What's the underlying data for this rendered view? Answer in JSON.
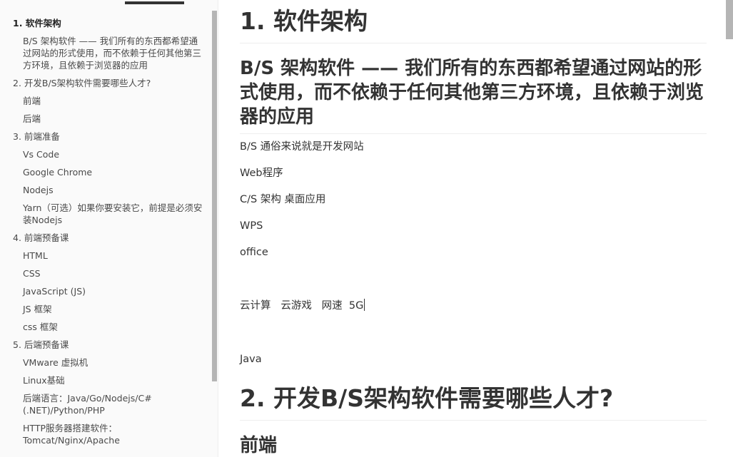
{
  "sidebar": {
    "outline": [
      {
        "level": 1,
        "label": "1. 软件架构",
        "active": true
      },
      {
        "level": 2,
        "label": "B/S 架构软件 —— 我们所有的东西都希望通过网站的形式使用，而不依赖于任何其他第三方环境，且依赖于浏览器的应用"
      },
      {
        "level": 1,
        "label": "2. 开发B/S架构软件需要哪些人才?"
      },
      {
        "level": 2,
        "label": "前端"
      },
      {
        "level": 2,
        "label": "后端"
      },
      {
        "level": 1,
        "label": "3. 前端准备"
      },
      {
        "level": 2,
        "label": "Vs Code"
      },
      {
        "level": 2,
        "label": "Google Chrome"
      },
      {
        "level": 2,
        "label": "Nodejs"
      },
      {
        "level": 2,
        "label": "Yarn（可选）如果你要安装它，前提是必须安装Nodejs"
      },
      {
        "level": 1,
        "label": "4. 前端预备课"
      },
      {
        "level": 2,
        "label": "HTML"
      },
      {
        "level": 2,
        "label": "CSS"
      },
      {
        "level": 2,
        "label": "JavaScript (JS)"
      },
      {
        "level": 2,
        "label": "JS 框架"
      },
      {
        "level": 2,
        "label": "css 框架"
      },
      {
        "level": 1,
        "label": "5. 后端预备课"
      },
      {
        "level": 2,
        "label": "VMware 虚拟机"
      },
      {
        "level": 2,
        "label": "Linux基础"
      },
      {
        "level": 2,
        "label": "后端语言：Java/Go/Nodejs/C#(.NET)/Python/PHP"
      },
      {
        "level": 2,
        "label": "HTTP服务器搭建软件：Tomcat/Nginx/Apache"
      }
    ]
  },
  "document": {
    "h1_1": "1. 软件架构",
    "h2_1": "B/S 架构软件 —— 我们所有的东西都希望通过网站的形式使用，而不依赖于任何其他第三方环境，且依赖于浏览器的应用",
    "paragraphs": [
      "B/S 通俗来说就是开发网站",
      "Web程序",
      "C/S 架构 桌面应用",
      "WPS",
      "office"
    ],
    "cloud_line": "云计算   云游戏   网速  5G",
    "java_line": "Java",
    "h1_2": "2. 开发B/S架构软件需要哪些人才?",
    "h2_2": "前端"
  },
  "colors": {
    "text": "#333333",
    "sidebar_bg": "#fafafa",
    "scrollbar": "#b5b5b5",
    "divider": "#eeeeee"
  }
}
